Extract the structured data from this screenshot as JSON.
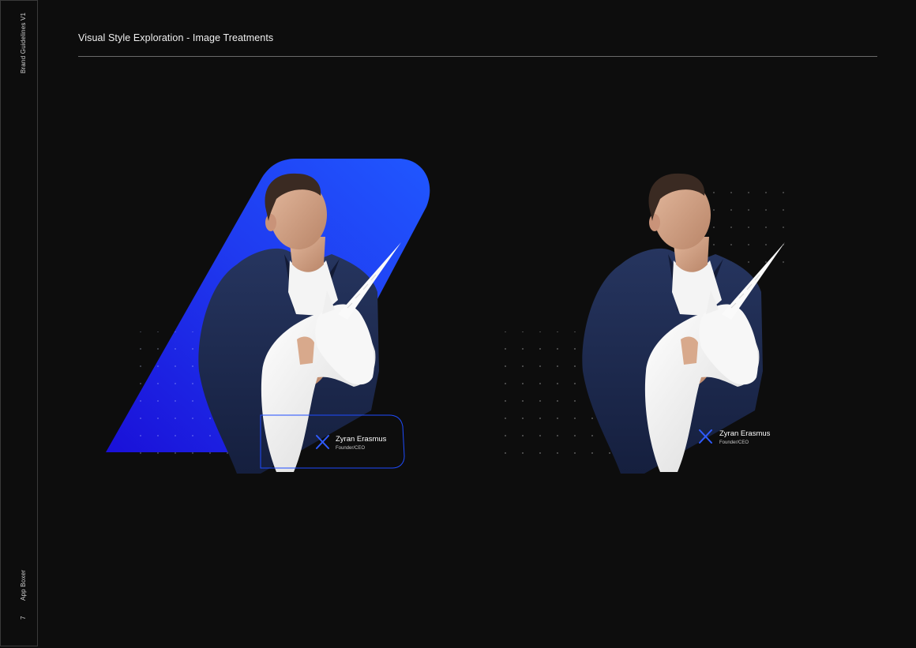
{
  "sidebar": {
    "top_label": "Brand Guidelines V1",
    "bottom_label": "App Boxer",
    "page_number": "7"
  },
  "header": {
    "title": "Visual Style Exploration - Image Treatments"
  },
  "treatments": [
    {
      "name": "Zyran Erasmus",
      "role": "Founder/CEO"
    },
    {
      "name": "Zyran Erasmus",
      "role": "Founder/CEO"
    }
  ],
  "colors": {
    "background": "#0d0d0d",
    "accent_blue": "#1f4cff",
    "accent_violet": "#1a10d8",
    "jacket_navy": "#1c2a52",
    "sculpture_white": "#f2f2f2"
  }
}
